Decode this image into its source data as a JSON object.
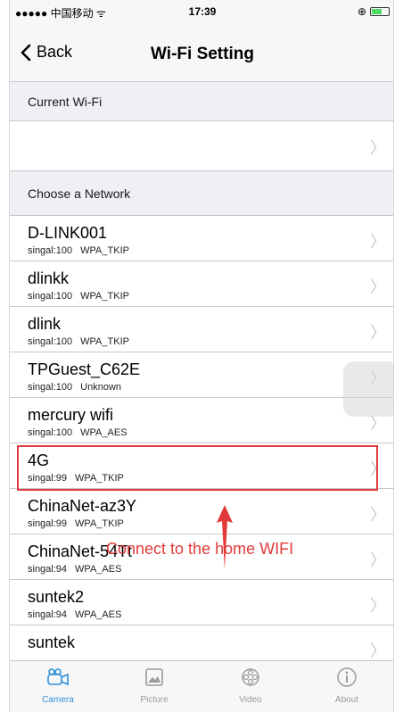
{
  "status_bar": {
    "carrier": "●●●●● 中国移动 ᯤ",
    "time": "17:39",
    "right_icons": "⊕",
    "battery_level": 0.55
  },
  "nav": {
    "back_label": "Back",
    "title": "Wi-Fi Setting"
  },
  "current_section": {
    "header": "Current Wi-Fi",
    "value": ""
  },
  "networks_section": {
    "header": "Choose a Network",
    "items": [
      {
        "name": "D-LINK001",
        "signal": "singal:100",
        "security": "WPA_TKIP"
      },
      {
        "name": "dlinkk",
        "signal": "singal:100",
        "security": "WPA_TKIP"
      },
      {
        "name": "dlink",
        "signal": "singal:100",
        "security": "WPA_TKIP"
      },
      {
        "name": "TPGuest_C62E",
        "signal": "singal:100",
        "security": "Unknown"
      },
      {
        "name": "mercury wifi",
        "signal": "singal:100",
        "security": "WPA_AES"
      },
      {
        "name": "4G",
        "signal": "singal:99",
        "security": "WPA_TKIP"
      },
      {
        "name": "ChinaNet-az3Y",
        "signal": "singal:99",
        "security": "WPA_TKIP"
      },
      {
        "name": "ChinaNet-54Tt",
        "signal": "singal:94",
        "security": "WPA_AES"
      },
      {
        "name": "suntek2",
        "signal": "singal:94",
        "security": "WPA_AES"
      },
      {
        "name": "suntek",
        "signal": "",
        "security": ""
      }
    ]
  },
  "annotation": {
    "text": "Connect to the home WIFI",
    "color": "#e23a3a"
  },
  "tabbar": {
    "tabs": [
      {
        "label": "Camera",
        "icon": "camera-icon",
        "active": true
      },
      {
        "label": "Picture",
        "icon": "picture-icon",
        "active": false
      },
      {
        "label": "Video",
        "icon": "video-icon",
        "active": false
      },
      {
        "label": "About",
        "icon": "info-icon",
        "active": false
      }
    ],
    "active_color": "#2f8fd8",
    "inactive_color": "#9a9a9a"
  }
}
